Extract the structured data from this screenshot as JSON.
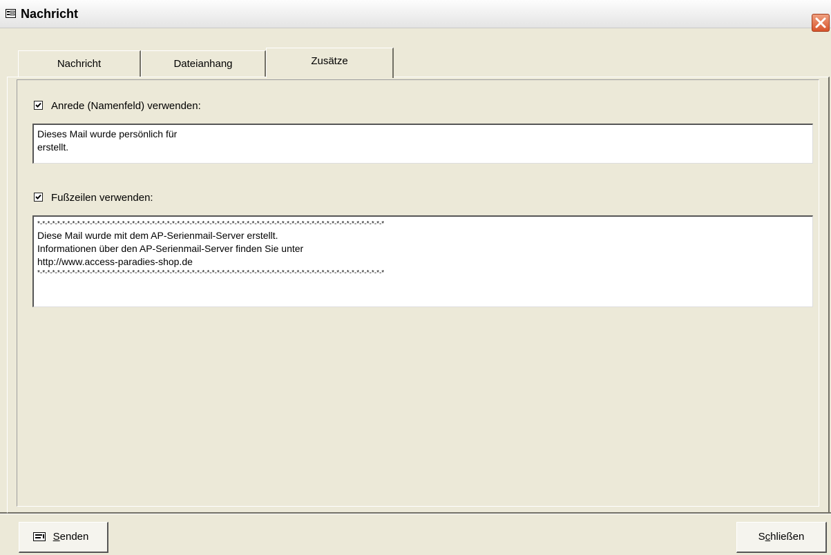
{
  "window": {
    "title": "Nachricht"
  },
  "tabs": [
    {
      "label": "Nachricht"
    },
    {
      "label": "Dateianhang"
    },
    {
      "label": "Zusätze"
    }
  ],
  "salutation": {
    "checkbox_checked": true,
    "label": "Anrede (Namenfeld) verwenden:",
    "text_line1": "Dieses Mail wurde persönlich für",
    "text_line2": "erstellt."
  },
  "footer": {
    "checkbox_checked": true,
    "label": "Fußzeilen verwenden:",
    "text_line1": "*-*-*-*-*-*-*-*-*-*-*-*-*-*-*-*-*-*-*-*-*-*-*-*-*-*-*-*-*-*-*-*-*-*-*-*-*-*-*-*-*-*-*-*-*-*-*-*-*-*-*-*-*-*-*-*-*-*-*-*-*-*-*-*-*-*-*-*-*-*",
    "text_line2": "Diese Mail wurde mit dem AP-Serienmail-Server erstellt.",
    "text_line3": "Informationen über den AP-Serienmail-Server finden Sie unter",
    "text_line4": "http://www.access-paradies-shop.de",
    "text_line5": "*-*-*-*-*-*-*-*-*-*-*-*-*-*-*-*-*-*-*-*-*-*-*-*-*-*-*-*-*-*-*-*-*-*-*-*-*-*-*-*-*-*-*-*-*-*-*-*-*-*-*-*-*-*-*-*-*-*-*-*-*-*-*-*-*-*-*-*-*-*"
  },
  "buttons": {
    "send_mnemonic": "S",
    "send_rest": "enden",
    "close_pre": "S",
    "close_mnemonic": "c",
    "close_rest": "hließen"
  },
  "icons": {
    "title": "form-icon",
    "close": "close-x-icon",
    "send": "send-form-icon",
    "checkbox": "checkmark-icon"
  },
  "colors": {
    "window_bg": "#ece9d8",
    "close_button": "#d8542c"
  }
}
